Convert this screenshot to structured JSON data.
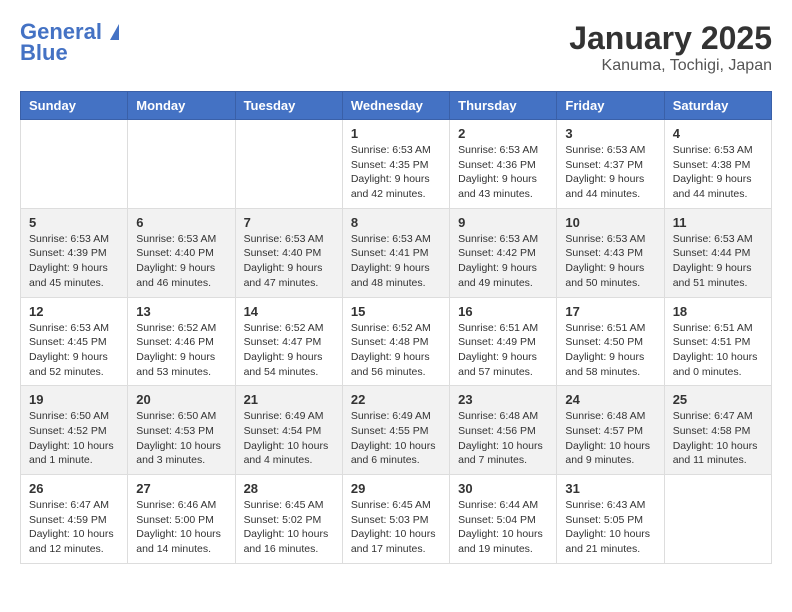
{
  "logo": {
    "line1": "General",
    "line2": "Blue"
  },
  "title": "January 2025",
  "subtitle": "Kanuma, Tochigi, Japan",
  "days_of_week": [
    "Sunday",
    "Monday",
    "Tuesday",
    "Wednesday",
    "Thursday",
    "Friday",
    "Saturday"
  ],
  "weeks": [
    [
      {
        "day": "",
        "info": ""
      },
      {
        "day": "",
        "info": ""
      },
      {
        "day": "",
        "info": ""
      },
      {
        "day": "1",
        "info": "Sunrise: 6:53 AM\nSunset: 4:35 PM\nDaylight: 9 hours and 42 minutes."
      },
      {
        "day": "2",
        "info": "Sunrise: 6:53 AM\nSunset: 4:36 PM\nDaylight: 9 hours and 43 minutes."
      },
      {
        "day": "3",
        "info": "Sunrise: 6:53 AM\nSunset: 4:37 PM\nDaylight: 9 hours and 44 minutes."
      },
      {
        "day": "4",
        "info": "Sunrise: 6:53 AM\nSunset: 4:38 PM\nDaylight: 9 hours and 44 minutes."
      }
    ],
    [
      {
        "day": "5",
        "info": "Sunrise: 6:53 AM\nSunset: 4:39 PM\nDaylight: 9 hours and 45 minutes."
      },
      {
        "day": "6",
        "info": "Sunrise: 6:53 AM\nSunset: 4:40 PM\nDaylight: 9 hours and 46 minutes."
      },
      {
        "day": "7",
        "info": "Sunrise: 6:53 AM\nSunset: 4:40 PM\nDaylight: 9 hours and 47 minutes."
      },
      {
        "day": "8",
        "info": "Sunrise: 6:53 AM\nSunset: 4:41 PM\nDaylight: 9 hours and 48 minutes."
      },
      {
        "day": "9",
        "info": "Sunrise: 6:53 AM\nSunset: 4:42 PM\nDaylight: 9 hours and 49 minutes."
      },
      {
        "day": "10",
        "info": "Sunrise: 6:53 AM\nSunset: 4:43 PM\nDaylight: 9 hours and 50 minutes."
      },
      {
        "day": "11",
        "info": "Sunrise: 6:53 AM\nSunset: 4:44 PM\nDaylight: 9 hours and 51 minutes."
      }
    ],
    [
      {
        "day": "12",
        "info": "Sunrise: 6:53 AM\nSunset: 4:45 PM\nDaylight: 9 hours and 52 minutes."
      },
      {
        "day": "13",
        "info": "Sunrise: 6:52 AM\nSunset: 4:46 PM\nDaylight: 9 hours and 53 minutes."
      },
      {
        "day": "14",
        "info": "Sunrise: 6:52 AM\nSunset: 4:47 PM\nDaylight: 9 hours and 54 minutes."
      },
      {
        "day": "15",
        "info": "Sunrise: 6:52 AM\nSunset: 4:48 PM\nDaylight: 9 hours and 56 minutes."
      },
      {
        "day": "16",
        "info": "Sunrise: 6:51 AM\nSunset: 4:49 PM\nDaylight: 9 hours and 57 minutes."
      },
      {
        "day": "17",
        "info": "Sunrise: 6:51 AM\nSunset: 4:50 PM\nDaylight: 9 hours and 58 minutes."
      },
      {
        "day": "18",
        "info": "Sunrise: 6:51 AM\nSunset: 4:51 PM\nDaylight: 10 hours and 0 minutes."
      }
    ],
    [
      {
        "day": "19",
        "info": "Sunrise: 6:50 AM\nSunset: 4:52 PM\nDaylight: 10 hours and 1 minute."
      },
      {
        "day": "20",
        "info": "Sunrise: 6:50 AM\nSunset: 4:53 PM\nDaylight: 10 hours and 3 minutes."
      },
      {
        "day": "21",
        "info": "Sunrise: 6:49 AM\nSunset: 4:54 PM\nDaylight: 10 hours and 4 minutes."
      },
      {
        "day": "22",
        "info": "Sunrise: 6:49 AM\nSunset: 4:55 PM\nDaylight: 10 hours and 6 minutes."
      },
      {
        "day": "23",
        "info": "Sunrise: 6:48 AM\nSunset: 4:56 PM\nDaylight: 10 hours and 7 minutes."
      },
      {
        "day": "24",
        "info": "Sunrise: 6:48 AM\nSunset: 4:57 PM\nDaylight: 10 hours and 9 minutes."
      },
      {
        "day": "25",
        "info": "Sunrise: 6:47 AM\nSunset: 4:58 PM\nDaylight: 10 hours and 11 minutes."
      }
    ],
    [
      {
        "day": "26",
        "info": "Sunrise: 6:47 AM\nSunset: 4:59 PM\nDaylight: 10 hours and 12 minutes."
      },
      {
        "day": "27",
        "info": "Sunrise: 6:46 AM\nSunset: 5:00 PM\nDaylight: 10 hours and 14 minutes."
      },
      {
        "day": "28",
        "info": "Sunrise: 6:45 AM\nSunset: 5:02 PM\nDaylight: 10 hours and 16 minutes."
      },
      {
        "day": "29",
        "info": "Sunrise: 6:45 AM\nSunset: 5:03 PM\nDaylight: 10 hours and 17 minutes."
      },
      {
        "day": "30",
        "info": "Sunrise: 6:44 AM\nSunset: 5:04 PM\nDaylight: 10 hours and 19 minutes."
      },
      {
        "day": "31",
        "info": "Sunrise: 6:43 AM\nSunset: 5:05 PM\nDaylight: 10 hours and 21 minutes."
      },
      {
        "day": "",
        "info": ""
      }
    ]
  ]
}
